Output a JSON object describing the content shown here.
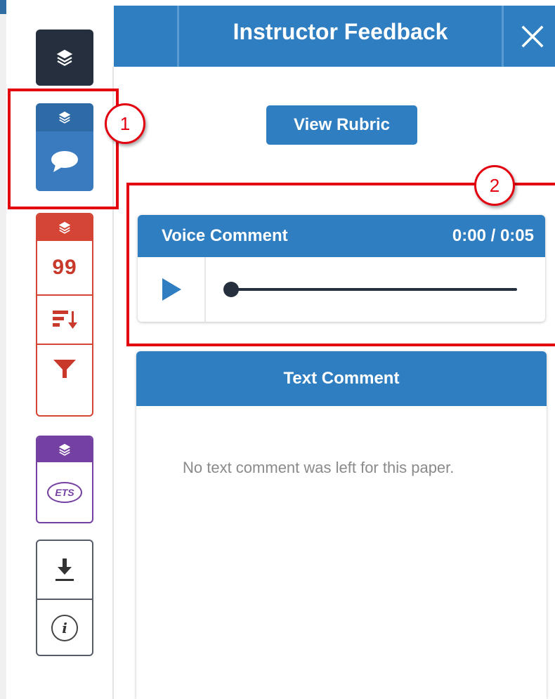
{
  "header": {
    "title": "Instructor Feedback",
    "close_icon": "close-icon"
  },
  "sidebar": {
    "layers_icon": "layers-icon",
    "feedback_group": {
      "icons": [
        "layers-icon",
        "comment-bubble-icon"
      ],
      "color": "#3a7bbf"
    },
    "grading_group": {
      "icons": [
        "layers-icon",
        "quote-icon",
        "sort-icon",
        "filter-icon"
      ],
      "quote_label": "99",
      "color": "#d44535"
    },
    "ets_group": {
      "icons": [
        "layers-icon",
        "ets-logo"
      ],
      "logo_text": "ETS",
      "color": "#7440a1"
    },
    "utility_group": {
      "icons": [
        "download-icon",
        "info-icon"
      ],
      "info_glyph": "i"
    }
  },
  "rubric_button": {
    "label": "View Rubric"
  },
  "voice_comment": {
    "title": "Voice Comment",
    "time": "0:00 / 0:05",
    "progress": 0,
    "play_icon": "play-icon"
  },
  "text_comment": {
    "title": "Text Comment",
    "body": "No text comment was left for this paper."
  },
  "annotations": [
    "1",
    "2"
  ],
  "colors": {
    "primary": "#2f7ec1",
    "annotation": "#e3000f",
    "dark": "#252f3d"
  }
}
